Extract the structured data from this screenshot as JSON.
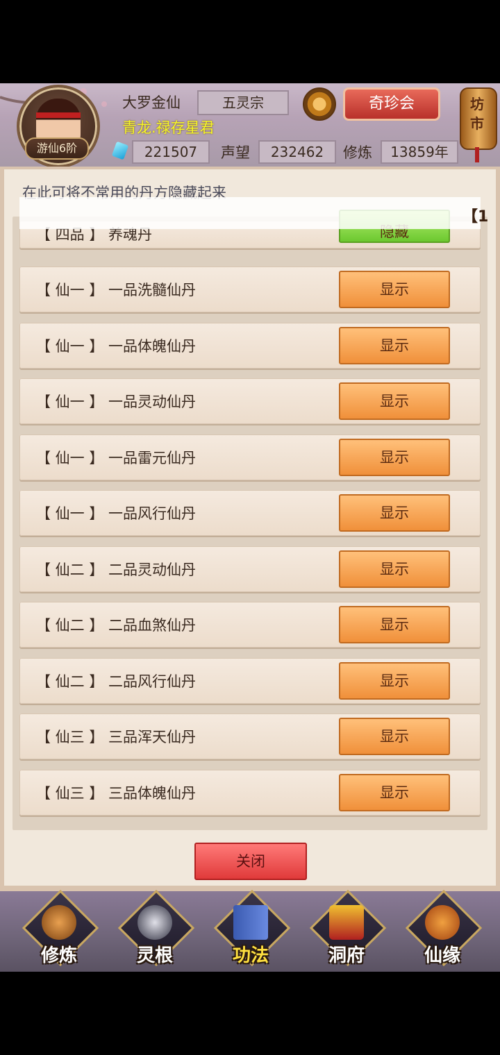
{
  "header": {
    "title": "大罗金仙",
    "sect": "五灵宗",
    "daohao": "青龙.禄存星君",
    "rank_badge": "游仙6阶",
    "spirit_stones": "221507",
    "prestige_label": "声望",
    "prestige": "232462",
    "cultivation_label": "修炼",
    "cultivation": "13859年",
    "treasure_button": "奇珍会",
    "market_button": "坊市",
    "settings_icon": "gear-icon"
  },
  "panel": {
    "hint": "在此可将不常用的丹方隐藏起来",
    "overflow_marker": "【1",
    "rows": [
      {
        "label": "【 四品 】 养魂丹",
        "button": "隐藏",
        "state": "hidden"
      },
      {
        "label": "【 仙一 】 一品洗髓仙丹",
        "button": "显示"
      },
      {
        "label": "【 仙一 】 一品体魄仙丹",
        "button": "显示"
      },
      {
        "label": "【 仙一 】 一品灵动仙丹",
        "button": "显示"
      },
      {
        "label": "【 仙一 】 一品雷元仙丹",
        "button": "显示"
      },
      {
        "label": "【 仙一 】 一品风行仙丹",
        "button": "显示"
      },
      {
        "label": "【 仙二 】 二品灵动仙丹",
        "button": "显示"
      },
      {
        "label": "【 仙二 】 二品血煞仙丹",
        "button": "显示"
      },
      {
        "label": "【 仙二 】 二品风行仙丹",
        "button": "显示"
      },
      {
        "label": "【 仙三 】 三品浑天仙丹",
        "button": "显示"
      },
      {
        "label": "【 仙三 】 三品体魄仙丹",
        "button": "显示"
      }
    ],
    "close_button": "关闭"
  },
  "nav": {
    "items": [
      {
        "label": "修炼",
        "icon": "monk-icon"
      },
      {
        "label": "灵根",
        "icon": "sword-icon"
      },
      {
        "label": "功法",
        "icon": "book-icon",
        "active": true
      },
      {
        "label": "洞府",
        "icon": "pagoda-icon"
      },
      {
        "label": "仙缘",
        "icon": "gourd-icon"
      }
    ]
  },
  "colors": {
    "show_button": "#f0903a",
    "hide_button": "#6cc830",
    "close_button": "#e03a3a",
    "daohao": "#f6f62a",
    "active_nav": "#ffe040"
  }
}
